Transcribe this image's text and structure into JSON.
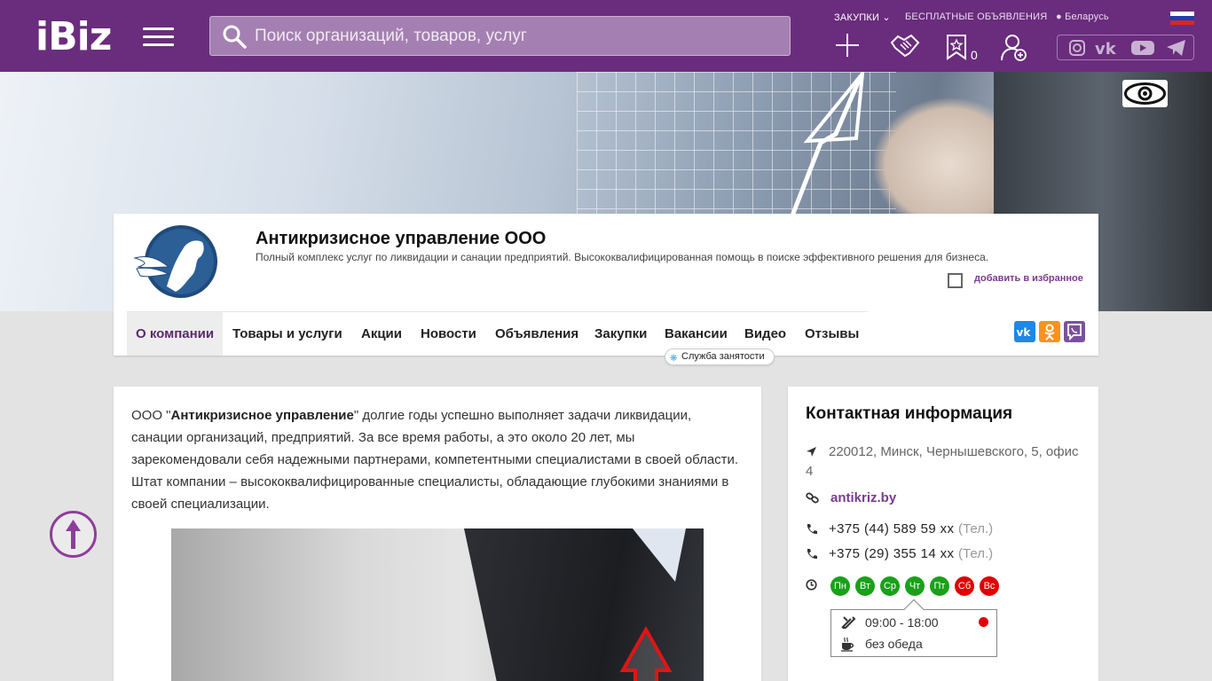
{
  "header": {
    "logo": "iBiz",
    "search_placeholder": "Поиск организаций, товаров, услуг",
    "links": {
      "purchases": "ЗАКУПКИ",
      "free_ads": "БЕСПЛАТНЫЕ ОБЪЯВЛЕНИЯ",
      "region": "Беларусь"
    },
    "favorites_count": "0"
  },
  "colors": {
    "brand": "#6a2c7d",
    "accent": "#7b3b8f",
    "day_open": "#1aa01a",
    "day_closed": "#e00000"
  },
  "company": {
    "title": "Антикризисное управление ООО",
    "description": "Полный комплекс услуг по ликвидации и санации предприятий. Высококвалифицированная помощь в поиске эффективного решения для бизнеса.",
    "favorite_label": "добавить в избранное"
  },
  "tabs": [
    {
      "label": "О компании",
      "active": true
    },
    {
      "label": "Товары и услуги"
    },
    {
      "label": "Акции"
    },
    {
      "label": "Новости"
    },
    {
      "label": "Объявления"
    },
    {
      "label": "Закупки"
    },
    {
      "label": "Вакансии"
    },
    {
      "label": "Видео"
    },
    {
      "label": "Отзывы"
    }
  ],
  "tooltip": "Служба занятости",
  "about": {
    "prefix": "ООО \"",
    "company_bold": "Антикризисное управление",
    "text": "\" долгие годы успешно выполняет задачи ликвидации, санации организаций, предприятий. За все время работы, а это около 20 лет, мы зарекомендовали себя надежными партнерами, компетентными специалистами в своей области. Штат компании – высококвалифицированные специалисты, обладающие глубокими знаниями в своей специализации."
  },
  "contacts": {
    "title": "Контактная информация",
    "address_line1": "220012, Минск, Чернышевского, 5, офис",
    "address_line2": "4",
    "website": "antikriz.by",
    "phones": [
      {
        "number": "+375 (44) 589 59 xx",
        "type": "(Тел.)"
      },
      {
        "number": "+375 (29) 355 14 xx",
        "type": "(Тел.)"
      }
    ],
    "days": [
      {
        "label": "Пн",
        "open": true
      },
      {
        "label": "Вт",
        "open": true
      },
      {
        "label": "Ср",
        "open": true
      },
      {
        "label": "Чт",
        "open": true
      },
      {
        "label": "Пт",
        "open": true
      },
      {
        "label": "Сб",
        "open": false
      },
      {
        "label": "Вс",
        "open": false
      }
    ],
    "hours": "09:00 - 18:00",
    "lunch": "без обеда"
  }
}
